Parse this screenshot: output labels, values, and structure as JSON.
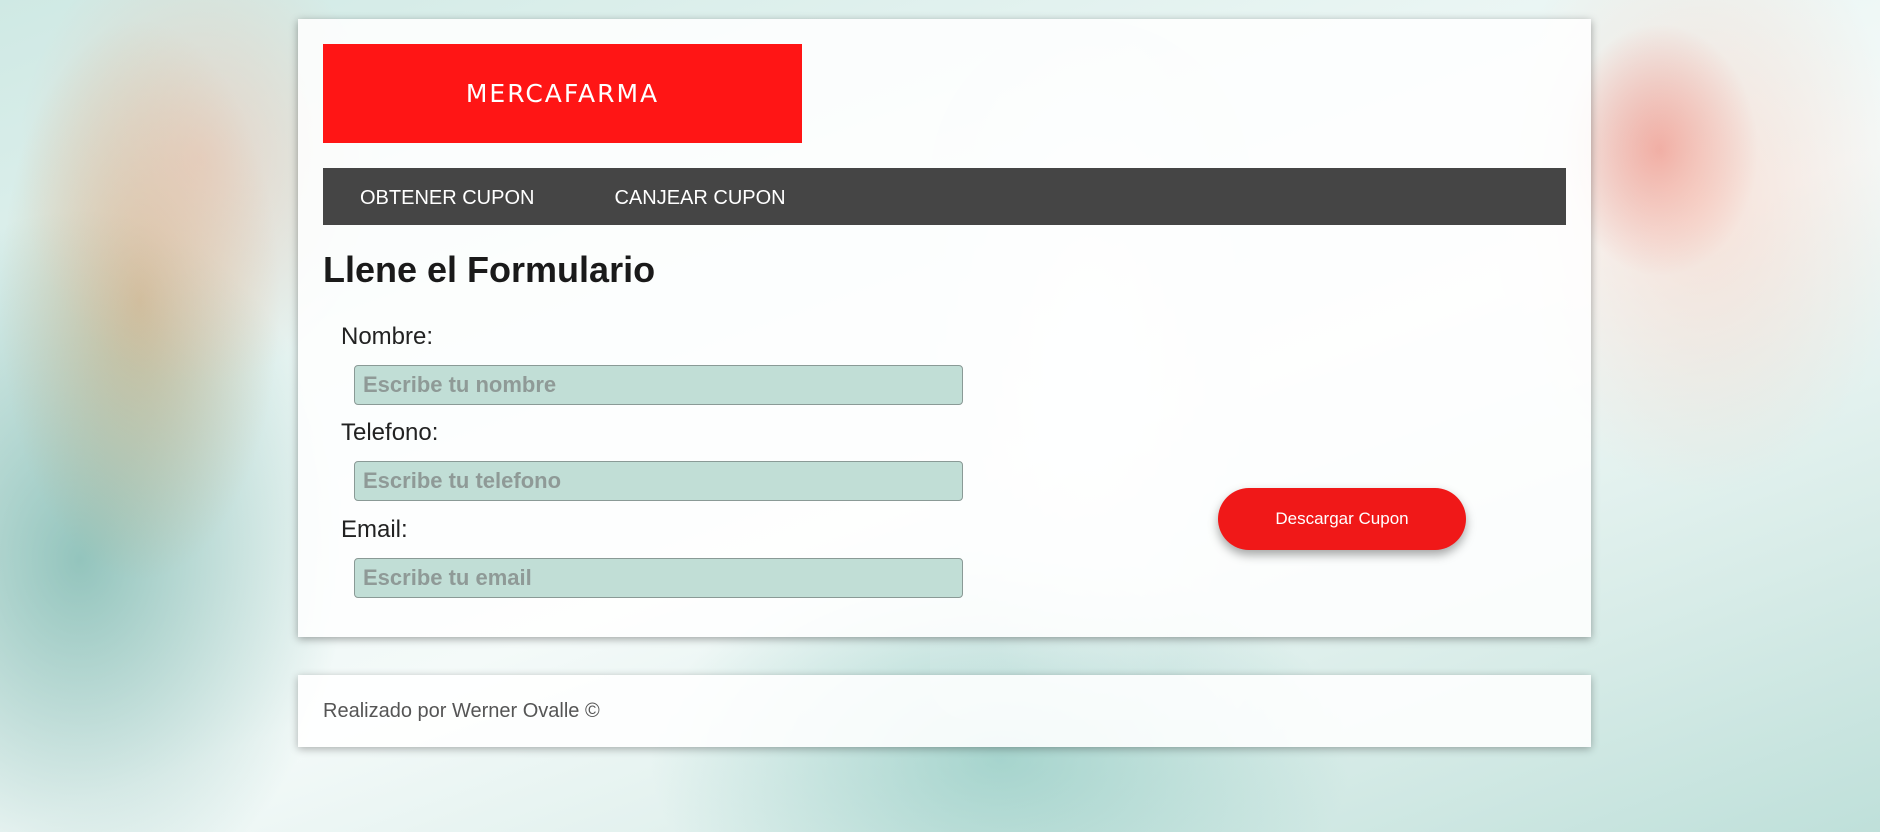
{
  "brand": {
    "logo_text": "MERCAFARMA",
    "accent_color": "#ff1515",
    "nav_bg_color": "#454545"
  },
  "nav": {
    "items": [
      {
        "label": "OBTENER CUPON"
      },
      {
        "label": "CANJEAR CUPON"
      }
    ]
  },
  "form": {
    "title": "Llene el Formulario",
    "fields": [
      {
        "label": "Nombre:",
        "placeholder": "Escribe tu nombre",
        "value": ""
      },
      {
        "label": "Telefono:",
        "placeholder": "Escribe tu telefono",
        "value": ""
      },
      {
        "label": "Email:",
        "placeholder": "Escribe tu email",
        "value": ""
      }
    ],
    "submit_label": "Descargar Cupon"
  },
  "footer": {
    "text": "Realizado por Werner Ovalle ©"
  }
}
